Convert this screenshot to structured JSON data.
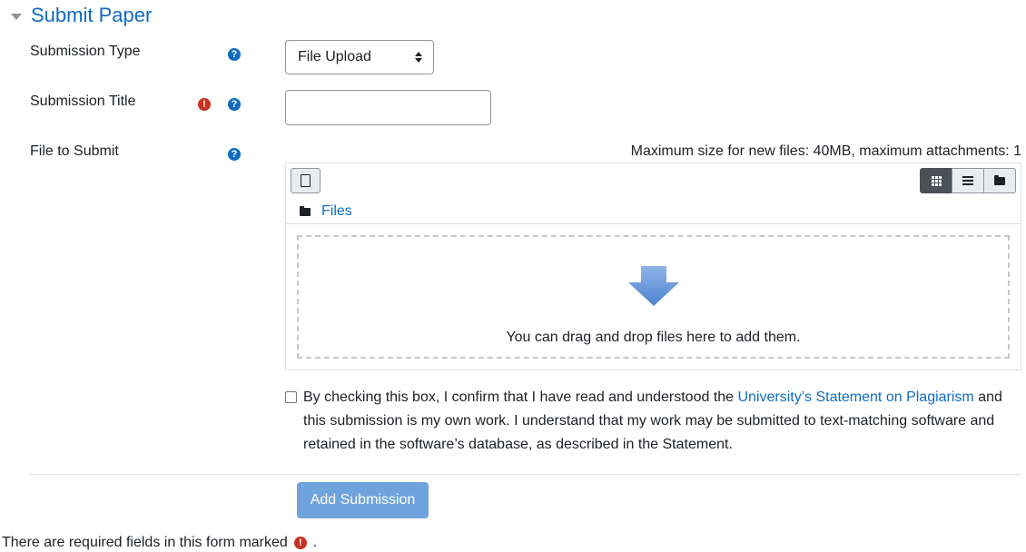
{
  "section": {
    "title": "Submit Paper"
  },
  "fields": {
    "submission_type": {
      "label": "Submission Type",
      "value": "File Upload"
    },
    "submission_title": {
      "label": "Submission Title",
      "value": ""
    },
    "file_to_submit": {
      "label": "File to Submit"
    }
  },
  "icons": {
    "help": "?",
    "required": "!"
  },
  "filemanager": {
    "max_size_text": "Maximum size for new files: 40MB, maximum attachments: 1",
    "path_label": "Files",
    "drop_text": "You can drag and drop files here to add them."
  },
  "agreement": {
    "text_before": "By checking this box, I confirm that I have read and understood the ",
    "link_text": "University’s Statement on Plagiarism",
    "text_after": " and this submission is my own work. I understand that my work may be submitted to text-matching software and retained in the software’s database, as described in the Statement."
  },
  "actions": {
    "submit_label": "Add Submission"
  },
  "footer": {
    "required_note": "There are required fields in this form marked",
    "required_note_end": "."
  },
  "colors": {
    "link": "#0f6cbf",
    "required": "#ca3120",
    "button": "#6fa3dd"
  }
}
